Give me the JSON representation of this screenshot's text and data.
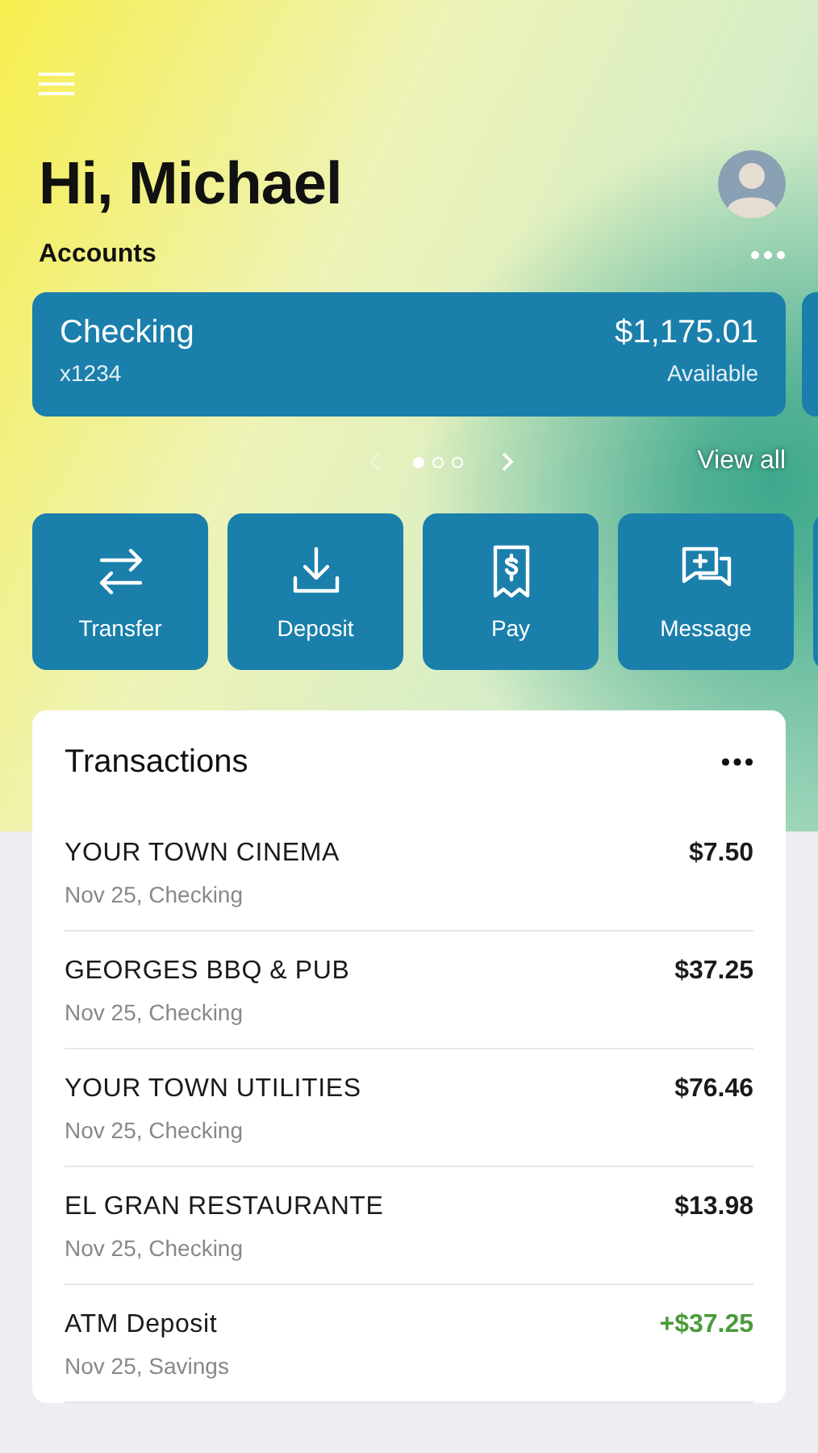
{
  "greeting": "Hi, Michael",
  "accounts": {
    "title": "Accounts",
    "cards": [
      {
        "name": "Checking",
        "number": "x1234",
        "balance": "$1,175.01",
        "balance_label": "Available"
      }
    ],
    "pages": [
      {
        "selected": true
      },
      {
        "selected": false
      },
      {
        "selected": false
      }
    ],
    "view_all": "View all"
  },
  "actions": [
    {
      "label": "Transfer",
      "kind": "transfer"
    },
    {
      "label": "Deposit",
      "kind": "deposit"
    },
    {
      "label": "Pay",
      "kind": "pay"
    },
    {
      "label": "Message",
      "kind": "message"
    }
  ],
  "transactions": {
    "title": "Transactions",
    "rows": [
      {
        "name": "YOUR TOWN CINEMA",
        "detail": "Nov 25, Checking",
        "amount": "$7.50",
        "kind": "debit"
      },
      {
        "name": "GEORGES BBQ & PUB",
        "detail": "Nov 25, Checking",
        "amount": "$37.25",
        "kind": "debit"
      },
      {
        "name": "YOUR TOWN UTILITIES",
        "detail": "Nov 25, Checking",
        "amount": "$76.46",
        "kind": "debit"
      },
      {
        "name": "EL GRAN RESTAURANTE",
        "detail": "Nov 25, Checking",
        "amount": "$13.98",
        "kind": "debit"
      },
      {
        "name": "ATM Deposit",
        "detail": "Nov 25, Savings",
        "amount": "+$37.25",
        "kind": "credit"
      }
    ]
  }
}
